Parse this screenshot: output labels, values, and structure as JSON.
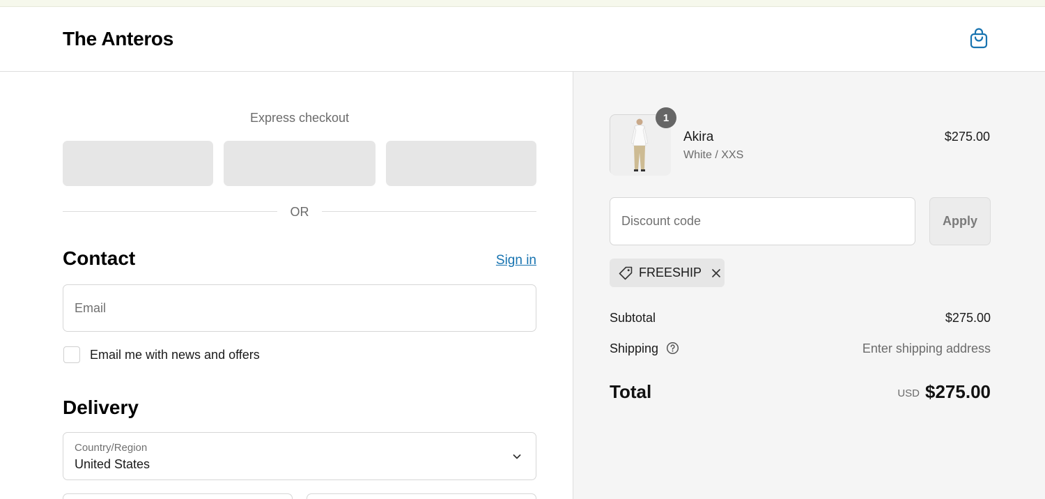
{
  "header": {
    "store_name": "The Anteros",
    "bag_icon": "shopping-bag-icon"
  },
  "express": {
    "label": "Express checkout",
    "buttons": [
      "",
      "",
      ""
    ],
    "divider_text": "OR"
  },
  "contact": {
    "title": "Contact",
    "sign_in_label": "Sign in",
    "email_placeholder": "Email",
    "newsletter_label": "Email me with news and offers",
    "newsletter_checked": false
  },
  "delivery": {
    "title": "Delivery",
    "country_label": "Country/Region",
    "country_value": "United States"
  },
  "order": {
    "item": {
      "quantity": "1",
      "name": "Akira",
      "variant": "White / XXS",
      "price": "$275.00"
    },
    "discount_placeholder": "Discount code",
    "apply_label": "Apply",
    "applied_code": "FREESHIP",
    "subtotal_label": "Subtotal",
    "subtotal_value": "$275.00",
    "shipping_label": "Shipping",
    "shipping_value": "Enter shipping address",
    "total_label": "Total",
    "total_currency": "USD",
    "total_value": "$275.00"
  },
  "colors": {
    "link": "#1773b0",
    "summary_bg": "#f5f5f5",
    "badge": "#666666"
  }
}
